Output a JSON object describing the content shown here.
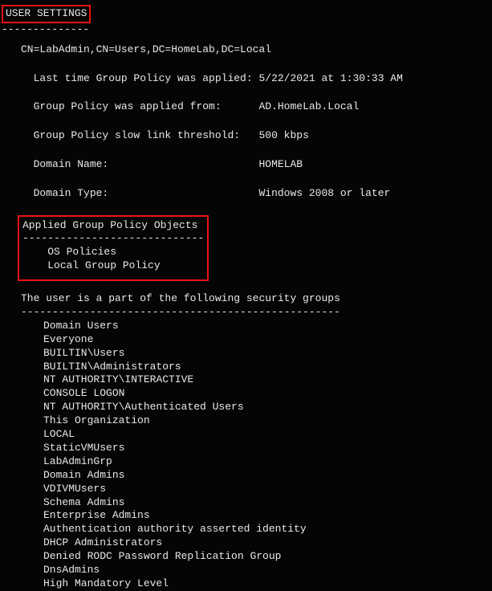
{
  "header": {
    "title": "USER SETTINGS",
    "rule": "--------------"
  },
  "user": {
    "dn": "CN=LabAdmin,CN=Users,DC=HomeLab,DC=Local",
    "lastApplyLabel": "Last time Group Policy was applied:",
    "lastApplyValue": "5/22/2021 at 1:30:33 AM",
    "appliedFromLabel": "Group Policy was applied from:",
    "appliedFromValue": "AD.HomeLab.Local",
    "slowLinkLabel": "Group Policy slow link threshold:",
    "slowLinkValue": "500 kbps",
    "domainNameLabel": "Domain Name:",
    "domainNameValue": "HOMELAB",
    "domainTypeLabel": "Domain Type:",
    "domainTypeValue": "Windows 2008 or later"
  },
  "gpo": {
    "title": "Applied Group Policy Objects",
    "rule": "-----------------------------",
    "items": [
      "OS Policies",
      "Local Group Policy"
    ]
  },
  "groups": {
    "title": "The user is a part of the following security groups",
    "rule": "---------------------------------------------------",
    "items": [
      "Domain Users",
      "Everyone",
      "BUILTIN\\Users",
      "BUILTIN\\Administrators",
      "NT AUTHORITY\\INTERACTIVE",
      "CONSOLE LOGON",
      "NT AUTHORITY\\Authenticated Users",
      "This Organization",
      "LOCAL",
      "StaticVMUsers",
      "LabAdminGrp",
      "Domain Admins",
      "VDIVMUsers",
      "Schema Admins",
      "Enterprise Admins",
      "Authentication authority asserted identity",
      "DHCP Administrators",
      "Denied RODC Password Replication Group",
      "DnsAdmins",
      "High Mandatory Level"
    ]
  }
}
